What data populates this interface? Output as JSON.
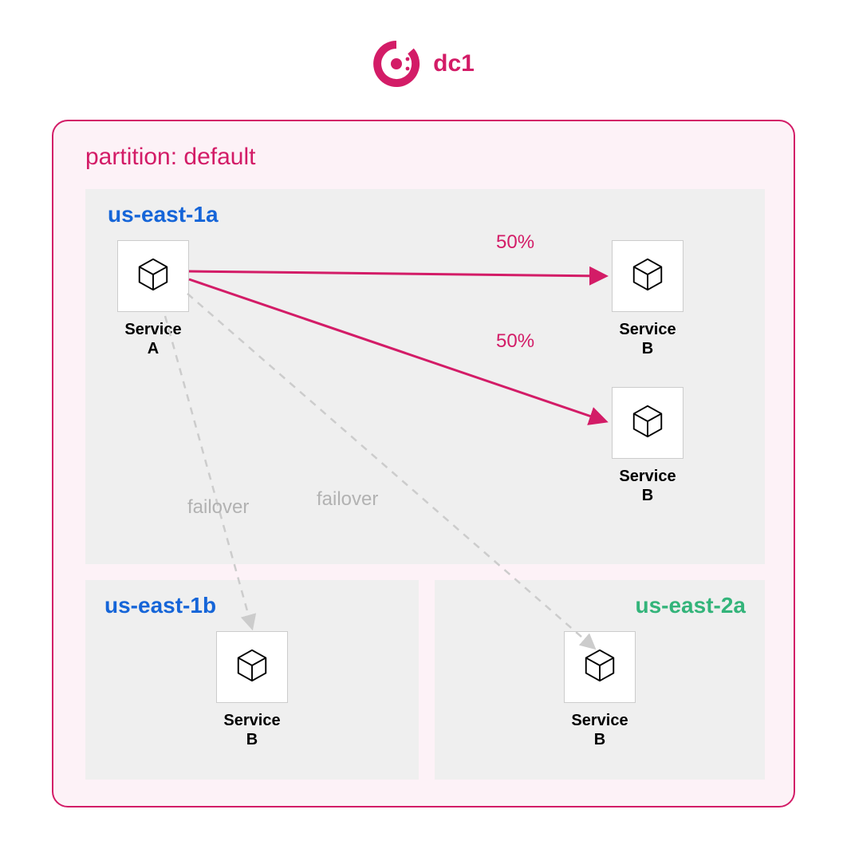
{
  "datacenter": {
    "label": "dc1"
  },
  "partition": {
    "label": "partition: default"
  },
  "colors": {
    "accent": "#d31c67",
    "blue": "#1565d8",
    "green": "#33b47a",
    "grey": "#b2b2b2",
    "zone_bg": "#efefef",
    "partition_bg": "#fdf2f7"
  },
  "zones": [
    {
      "id": "us-east-1a",
      "label": "us-east-1a",
      "label_color": "blue",
      "services": [
        {
          "id": "svc-a",
          "name_line1": "Service",
          "name_line2": "A"
        },
        {
          "id": "svc-b-1",
          "name_line1": "Service",
          "name_line2": "B"
        },
        {
          "id": "svc-b-2",
          "name_line1": "Service",
          "name_line2": "B"
        }
      ]
    },
    {
      "id": "us-east-1b",
      "label": "us-east-1b",
      "label_color": "blue",
      "services": [
        {
          "id": "svc-b-1b",
          "name_line1": "Service",
          "name_line2": "B"
        }
      ]
    },
    {
      "id": "us-east-2a",
      "label": "us-east-2a",
      "label_color": "green",
      "services": [
        {
          "id": "svc-b-2a",
          "name_line1": "Service",
          "name_line2": "B"
        }
      ]
    }
  ],
  "connections": [
    {
      "from": "svc-a",
      "to": "svc-b-1",
      "label": "50%",
      "type": "primary"
    },
    {
      "from": "svc-a",
      "to": "svc-b-2",
      "label": "50%",
      "type": "primary"
    },
    {
      "from": "svc-a",
      "to": "svc-b-1b",
      "label": "failover",
      "type": "failover"
    },
    {
      "from": "svc-a",
      "to": "svc-b-2a",
      "label": "failover",
      "type": "failover"
    }
  ]
}
